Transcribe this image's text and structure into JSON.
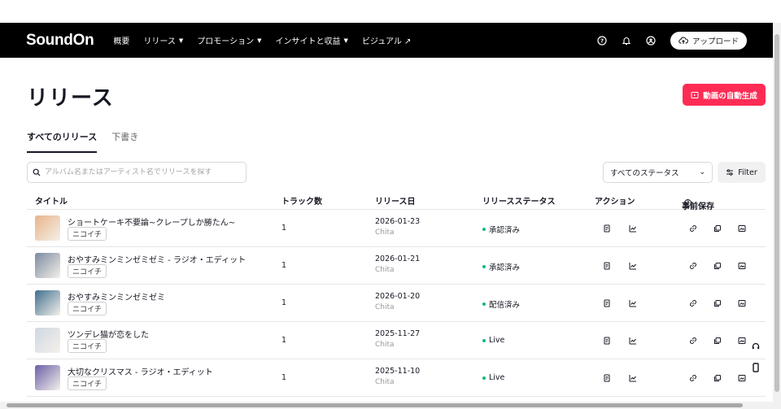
{
  "header": {
    "logo": "SoundOn",
    "nav": [
      {
        "label": "概要",
        "caret": false
      },
      {
        "label": "リリース",
        "caret": true
      },
      {
        "label": "プロモーション",
        "caret": true
      },
      {
        "label": "インサイトと収益",
        "caret": true
      },
      {
        "label": "ビジュアル ↗",
        "caret": false
      }
    ],
    "upload_label": "アップロード"
  },
  "page": {
    "title": "リリース",
    "generate_button": "動画の自動生成",
    "tabs": [
      "すべてのリリース",
      "下書き"
    ],
    "search_placeholder": "アルバム名またはアーティスト名でリリースを探す",
    "status_filter": "すべてのステータス",
    "filter_label": "Filter"
  },
  "table": {
    "columns": [
      "タイトル",
      "トラック数",
      "リリース日",
      "リリースステータス",
      "アクション",
      "事前保存"
    ],
    "rows": [
      {
        "title": "ショートケーキ不要論~クレープしか勝たん~",
        "artist": "ニコイチ",
        "tracks": "1",
        "date": "2026-01-23",
        "sub": "Chita",
        "status": "承認済み",
        "cover": "#e8b48a"
      },
      {
        "title": "おやすみミンミンゼミゼミ - ラジオ・エディット",
        "artist": "ニコイチ",
        "tracks": "1",
        "date": "2026-01-21",
        "sub": "Chita",
        "status": "承認済み",
        "cover": "#7a8aa0"
      },
      {
        "title": "おやすみミンミンゼミゼミ",
        "artist": "ニコイチ",
        "tracks": "1",
        "date": "2026-01-20",
        "sub": "Chita",
        "status": "配信済み",
        "cover": "#3f6f8f"
      },
      {
        "title": "ツンデレ猫が恋をした",
        "artist": "ニコイチ",
        "tracks": "1",
        "date": "2025-11-27",
        "sub": "Chita",
        "status": "Live",
        "cover": "#cfd8e3"
      },
      {
        "title": "大切なクリスマス - ラジオ・エディット",
        "artist": "ニコイチ",
        "tracks": "1",
        "date": "2025-11-10",
        "sub": "Chita",
        "status": "Live",
        "cover": "#6b5fa8"
      }
    ]
  }
}
